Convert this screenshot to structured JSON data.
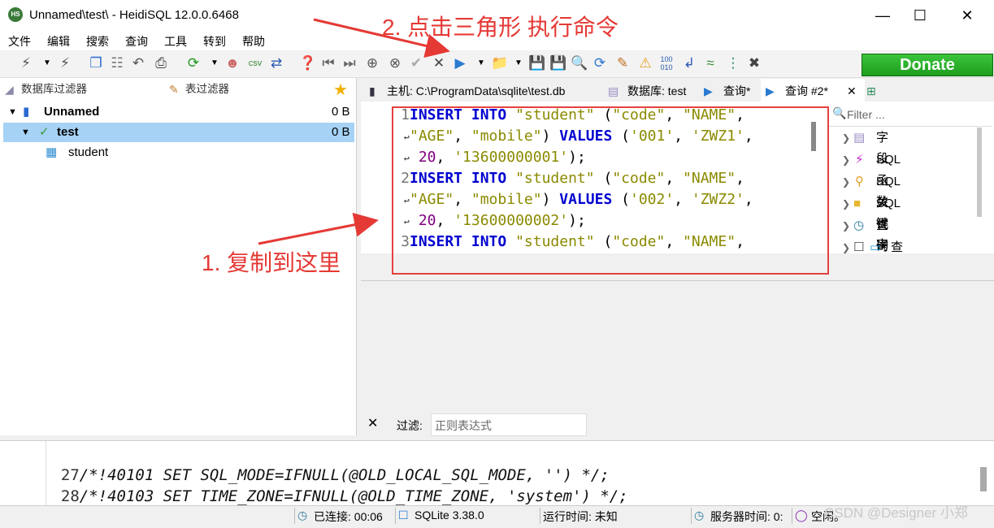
{
  "window": {
    "title": "Unnamed\\test\\ - HeidiSQL 12.0.0.6468",
    "icon_label": "HS"
  },
  "menu": [
    "文件",
    "编辑",
    "搜索",
    "查询",
    "工具",
    "转到",
    "帮助"
  ],
  "toolbar": {
    "donate_label": "Donate"
  },
  "left_panel": {
    "db_filter_label": "数据库过滤器",
    "table_filter_label": "表过滤器",
    "tree": [
      {
        "label": "Unnamed",
        "size": "0 B"
      },
      {
        "label": "test",
        "size": "0 B"
      },
      {
        "label": "student",
        "size": ""
      }
    ]
  },
  "tabs": {
    "host": "主机: C:\\ProgramData\\sqlite\\test.db",
    "database": "数据库: test",
    "query1": "查询*",
    "query2": "查询 #2*"
  },
  "editor": {
    "lines": [
      {
        "no": "1",
        "segments": [
          [
            "kw",
            "INSERT"
          ],
          [
            "plain",
            " "
          ],
          [
            "kw",
            "INTO"
          ],
          [
            "plain",
            " "
          ],
          [
            "str",
            "\"student\""
          ],
          [
            "plain",
            " ("
          ],
          [
            "str",
            "\"code\""
          ],
          [
            "plain",
            ", "
          ],
          [
            "str",
            "\"NAME\""
          ],
          [
            "plain",
            ","
          ]
        ]
      },
      {
        "no": "",
        "wrap": true,
        "segments": [
          [
            "str",
            "\"AGE\""
          ],
          [
            "plain",
            ", "
          ],
          [
            "str",
            "\"mobile\""
          ],
          [
            "plain",
            ") "
          ],
          [
            "kw",
            "VALUES"
          ],
          [
            "plain",
            " ("
          ],
          [
            "str",
            "'001'"
          ],
          [
            "plain",
            ", "
          ],
          [
            "str",
            "'ZWZ1'"
          ],
          [
            "plain",
            ","
          ]
        ]
      },
      {
        "no": "",
        "wrap": true,
        "segments": [
          [
            "plain",
            " "
          ],
          [
            "num",
            "20"
          ],
          [
            "plain",
            ", "
          ],
          [
            "str",
            "'13600000001'"
          ],
          [
            "plain",
            ");"
          ]
        ]
      },
      {
        "no": "2",
        "segments": [
          [
            "kw",
            "INSERT"
          ],
          [
            "plain",
            " "
          ],
          [
            "kw",
            "INTO"
          ],
          [
            "plain",
            " "
          ],
          [
            "str",
            "\"student\""
          ],
          [
            "plain",
            " ("
          ],
          [
            "str",
            "\"code\""
          ],
          [
            "plain",
            ", "
          ],
          [
            "str",
            "\"NAME\""
          ],
          [
            "plain",
            ","
          ]
        ]
      },
      {
        "no": "",
        "wrap": true,
        "segments": [
          [
            "str",
            "\"AGE\""
          ],
          [
            "plain",
            ", "
          ],
          [
            "str",
            "\"mobile\""
          ],
          [
            "plain",
            ") "
          ],
          [
            "kw",
            "VALUES"
          ],
          [
            "plain",
            " ("
          ],
          [
            "str",
            "'002'"
          ],
          [
            "plain",
            ", "
          ],
          [
            "str",
            "'ZWZ2'"
          ],
          [
            "plain",
            ","
          ]
        ]
      },
      {
        "no": "",
        "wrap": true,
        "segments": [
          [
            "plain",
            " "
          ],
          [
            "num",
            "20"
          ],
          [
            "plain",
            ", "
          ],
          [
            "str",
            "'13600000002'"
          ],
          [
            "plain",
            ");"
          ]
        ]
      },
      {
        "no": "3",
        "segments": [
          [
            "kw",
            "INSERT"
          ],
          [
            "plain",
            " "
          ],
          [
            "kw",
            "INTO"
          ],
          [
            "plain",
            " "
          ],
          [
            "str",
            "\"student\""
          ],
          [
            "plain",
            " ("
          ],
          [
            "str",
            "\"code\""
          ],
          [
            "plain",
            ", "
          ],
          [
            "str",
            "\"NAME\""
          ],
          [
            "plain",
            ","
          ]
        ]
      }
    ]
  },
  "helpers": {
    "filter_placeholder": "Filter ...",
    "items": [
      "字段",
      "SQL 函数",
      "SQL 关键字",
      "SQL 代码片段",
      "查询历史",
      "查询分析"
    ]
  },
  "result_filter": {
    "label": "过滤:",
    "placeholder": "正则表达式"
  },
  "log": [
    {
      "no": "27",
      "text": "/*!40101 SET SQL_MODE=IFNULL(@OLD_LOCAL_SQL_MODE, '') */;"
    },
    {
      "no": "28",
      "text": "/*!40103 SET TIME_ZONE=IFNULL(@OLD_TIME_ZONE, 'system') */;"
    }
  ],
  "status": {
    "connected": "已连接: 00:06",
    "version": "SQLite 3.38.0",
    "runtime": "运行时间: 未知",
    "server_time": "服务器时间: 0:",
    "idle": "空闲。"
  },
  "annotations": {
    "step1": "1. 复制到这里",
    "step2": "2. 点击三角形 执行命令",
    "watermark": "CSDN @Designer 小郑"
  },
  "colors": {
    "annotation": "#e53935",
    "keyword": "#0000d0",
    "string": "#8a8a00",
    "number": "#800080",
    "donate": "#1e9e1e"
  }
}
